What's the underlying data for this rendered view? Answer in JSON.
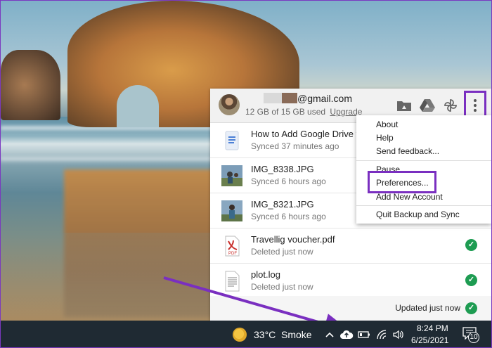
{
  "account": {
    "email_suffix": "@gmail.com",
    "storage_text": "12 GB of 15 GB used",
    "upgrade_label": "Upgrade"
  },
  "header_icons": [
    "drive-folder-icon",
    "google-drive-icon",
    "google-photos-pinwheel-icon",
    "more-vertical-icon"
  ],
  "files": [
    {
      "name": "How to Add Google Drive to",
      "status": "Synced 37 minutes ago",
      "thumb": "google-doc-icon",
      "checked": false
    },
    {
      "name": "IMG_8338.JPG",
      "status": "Synced 6 hours ago",
      "thumb": "photo-thumbnail",
      "checked": false
    },
    {
      "name": "IMG_8321.JPG",
      "status": "Synced 6 hours ago",
      "thumb": "photo-thumbnail",
      "checked": false
    },
    {
      "name": "Travellig voucher.pdf",
      "status": "Deleted just now",
      "thumb": "pdf-icon",
      "checked": true
    },
    {
      "name": "plot.log",
      "status": "Deleted just now",
      "thumb": "text-file-icon",
      "checked": true
    }
  ],
  "footer": {
    "status": "Updated just now"
  },
  "menu": {
    "items": [
      "About",
      "Help",
      "Send feedback...",
      "Pause",
      "Preferences...",
      "Add New Account",
      "Quit Backup and Sync"
    ]
  },
  "taskbar": {
    "temperature": "33°C",
    "weather": "Smoke",
    "time": "8:24 PM",
    "date": "6/25/2021",
    "notification_count": "10"
  },
  "colors": {
    "highlight": "#7a2fc0",
    "check": "#1e9c52",
    "taskbar": "#1f2a33"
  }
}
